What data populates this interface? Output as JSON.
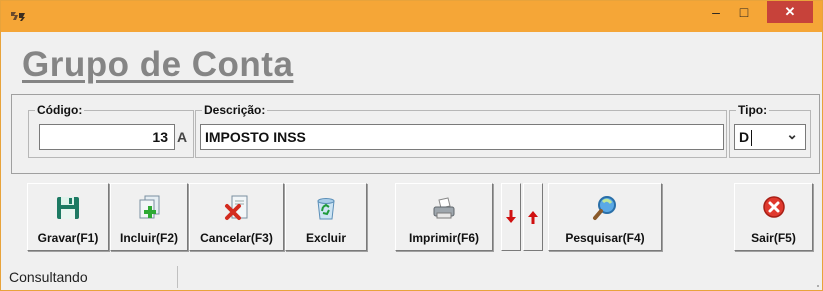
{
  "window": {
    "min_symbol": "–",
    "max_symbol": "□",
    "close_symbol": "✕"
  },
  "page": {
    "title": "Grupo de Conta"
  },
  "form": {
    "codigo": {
      "label": "Código:",
      "value": "13",
      "suffix": "A"
    },
    "descricao": {
      "label": "Descrição:",
      "value": "IMPOSTO INSS"
    },
    "tipo": {
      "label": "Tipo:",
      "value": "D",
      "chevron": "⌄"
    }
  },
  "toolbar": {
    "gravar": "Gravar(F1)",
    "incluir": "Incluir(F2)",
    "cancelar": "Cancelar(F3)",
    "excluir": "Excluir",
    "imprimir": "Imprimir(F6)",
    "pesquisar": "Pesquisar(F4)",
    "sair": "Sair(F5)"
  },
  "status": {
    "text": "Consultando"
  },
  "colors": {
    "titlebar": "#f5a637",
    "close": "#c7423a",
    "title_text": "#858585",
    "arrow_red": "#d01010"
  },
  "icons": {
    "app": "app-icon",
    "gravar": "floppy-disk-icon",
    "incluir": "add-document-icon",
    "cancelar": "cancel-document-icon",
    "excluir": "recycle-bin-icon",
    "imprimir": "printer-icon",
    "down": "arrow-down-icon",
    "up": "arrow-up-icon",
    "pesquisar": "magnifier-icon",
    "sair": "exit-icon"
  }
}
